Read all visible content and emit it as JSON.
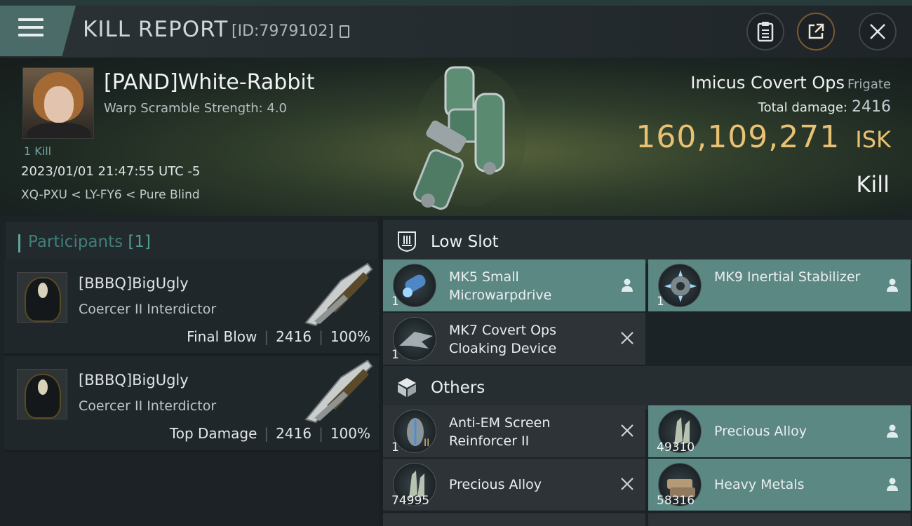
{
  "header": {
    "title": "KILL REPORT",
    "report_id": "[ID:7979102]"
  },
  "victim": {
    "name": "[PAND]White-Rabbit",
    "warp_scramble": "Warp Scramble Strength: 4.0",
    "kills": "1 Kill",
    "datetime": "2023/01/01 21:47:55 UTC -5",
    "location": "XQ-PXU < LY-FY6 < Pure Blind"
  },
  "ship": {
    "name": "Imicus Covert Ops",
    "class": "Frigate",
    "total_damage_label": "Total damage:",
    "total_damage": "2416",
    "isk_value": "160,109,271",
    "isk_unit": "ISK",
    "result": "Kill"
  },
  "participants": {
    "title": "Participants",
    "count": "[1]",
    "rows": [
      {
        "name": "[BBBQ]BigUgly",
        "ship": "Coercer II Interdictor",
        "role": "Final Blow",
        "damage": "2416",
        "percent": "100%"
      },
      {
        "name": "[BBBQ]BigUgly",
        "ship": "Coercer II Interdictor",
        "role": "Top Damage",
        "damage": "2416",
        "percent": "100%"
      }
    ]
  },
  "low_slot": {
    "title": "Low Slot",
    "items": [
      {
        "name": "MK5 Small Microwarpdrive",
        "qty": "1",
        "status": "dropped"
      },
      {
        "name": "MK9 Inertial Stabilizer",
        "qty": "1",
        "status": "dropped"
      },
      {
        "name": "MK7 Covert Ops Cloaking Device",
        "qty": "1",
        "status": "destroyed"
      }
    ]
  },
  "others": {
    "title": "Others",
    "items": [
      {
        "name": "Anti-EM Screen Reinforcer II",
        "qty": "1",
        "status": "destroyed",
        "tier": "II"
      },
      {
        "name": "Precious Alloy",
        "qty": "49310",
        "status": "dropped"
      },
      {
        "name": "Precious Alloy",
        "qty": "74995",
        "status": "destroyed"
      },
      {
        "name": "Heavy Metals",
        "qty": "58316",
        "status": "dropped"
      }
    ]
  },
  "colors": {
    "isk": "#e8c173",
    "dropped_bg": "#5c8884",
    "destroyed_bg": "#2d3337",
    "accent": "#5fa79f"
  },
  "icons": {
    "menu": "menu-icon",
    "clipboard": "clipboard-icon",
    "share": "share-icon",
    "close": "close-icon",
    "dropped": "person-icon",
    "destroyed": "x-icon"
  }
}
